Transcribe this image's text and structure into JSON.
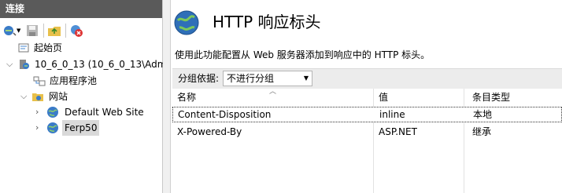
{
  "connections": {
    "header": "连接",
    "toolbar": [
      {
        "name": "connect-icon"
      },
      {
        "name": "save-icon"
      },
      {
        "name": "folder-up-icon"
      },
      {
        "name": "disconnect-icon"
      }
    ],
    "tree": {
      "start_page": "起始页",
      "server": "10_6_0_13 (10_6_0_13\\Adm",
      "app_pools": "应用程序池",
      "sites": "网站",
      "site1": "Default Web Site",
      "site2": "Ferp50"
    }
  },
  "main": {
    "title": "HTTP 响应标头",
    "description": "使用此功能配置从 Web 服务器添加到响应中的 HTTP 标头。",
    "filter_label": "分组依据:",
    "filter_value": "不进行分组",
    "columns": [
      "名称",
      "值",
      "条目类型"
    ],
    "rows": [
      {
        "name": "Content-Disposition",
        "value": "inline",
        "type": "本地"
      },
      {
        "name": "X-Powered-By",
        "value": "ASP.NET",
        "type": "继承"
      }
    ]
  },
  "colors": {
    "header_bg": "#5a5a5a",
    "selection": "#d9d9d9"
  }
}
